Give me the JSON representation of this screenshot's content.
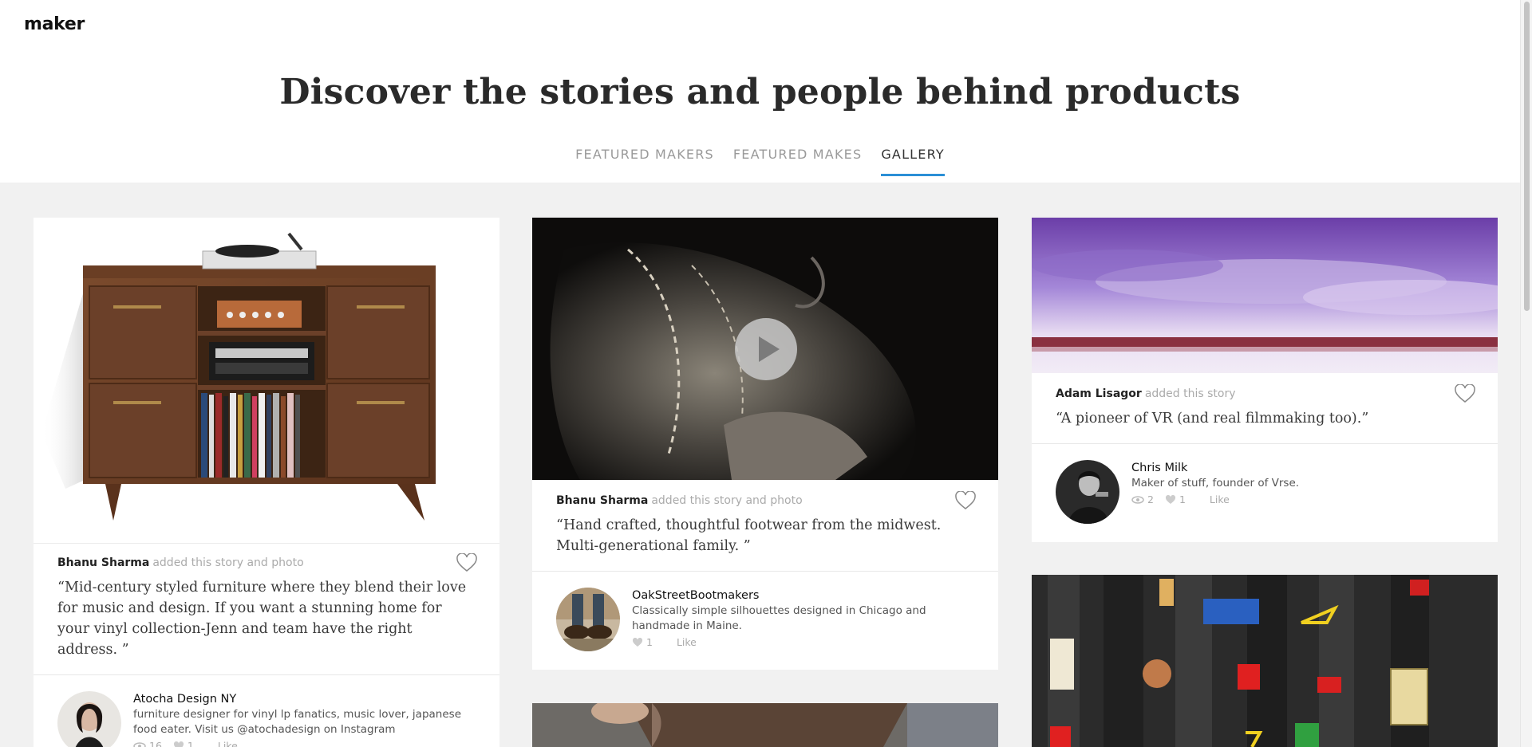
{
  "site": {
    "logo": "maker"
  },
  "hero": {
    "title": "Discover the stories and people behind products"
  },
  "tabs": [
    {
      "label": "FEATURED MAKERS",
      "active": false
    },
    {
      "label": "FEATURED MAKES",
      "active": false
    },
    {
      "label": "GALLERY",
      "active": true
    }
  ],
  "colors": {
    "accent": "#2b8fd6",
    "background": "#f1f1f1"
  },
  "cards": [
    {
      "media_type": "photo",
      "added_by": "Bhanu Sharma",
      "action": "added this story and photo",
      "quote": "“Mid-century styled furniture where they blend their love for music and design. If you want a stunning home for your vinyl collection-Jenn and team have the right address. ”",
      "maker": {
        "name": "Atocha Design NY",
        "description": "furniture designer for vinyl lp fanatics, music lover, japanese food eater. Visit us @atochadesign on Instagram",
        "views": "16",
        "likes": "1",
        "like_label": "Like"
      }
    },
    {
      "media_type": "video",
      "added_by": "Bhanu Sharma",
      "action": "added this story and photo",
      "quote": "“Hand crafted, thoughtful footwear from the midwest. Multi-generational family. ”",
      "maker": {
        "name": "OakStreetBootmakers",
        "description": "Classically simple silhouettes designed in Chicago and handmade in Maine.",
        "likes": "1",
        "like_label": "Like"
      }
    },
    {
      "media_type": "photo",
      "added_by": "Adam Lisagor",
      "action": "added this story",
      "quote": "“A pioneer of VR (and real filmmaking too).”",
      "maker": {
        "name": "Chris Milk",
        "description": "Maker of stuff, founder of Vrse.",
        "views": "2",
        "likes": "1",
        "like_label": "Like"
      }
    }
  ]
}
